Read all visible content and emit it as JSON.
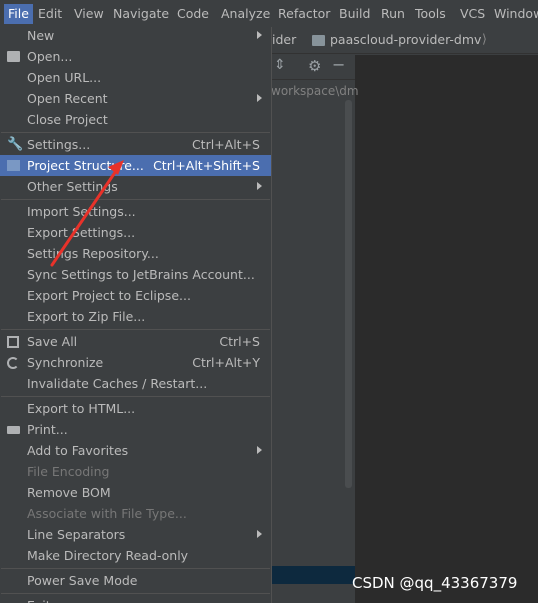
{
  "menubar": {
    "items": [
      "File",
      "Edit",
      "View",
      "Navigate",
      "Code",
      "Analyze",
      "Refactor",
      "Build",
      "Run",
      "Tools",
      "VCS",
      "Window"
    ]
  },
  "breadcrumb": {
    "first": "ider",
    "project": "paascloud-provider-dmv",
    "sep": "⟩"
  },
  "editor": {
    "path_text": "workspace\\dm"
  },
  "file_menu": {
    "items": {
      "new": {
        "label": "New"
      },
      "open": {
        "label": "Open..."
      },
      "open_url": {
        "label": "Open URL..."
      },
      "open_recent": {
        "label": "Open Recent"
      },
      "close_project": {
        "label": "Close Project"
      },
      "settings": {
        "label": "Settings...",
        "shortcut": "Ctrl+Alt+S"
      },
      "project_structure": {
        "label": "Project Structure...",
        "shortcut": "Ctrl+Alt+Shift+S"
      },
      "other_settings": {
        "label": "Other Settings"
      },
      "import_settings": {
        "label": "Import Settings..."
      },
      "export_settings": {
        "label": "Export Settings..."
      },
      "settings_repository": {
        "label": "Settings Repository..."
      },
      "sync_settings": {
        "label": "Sync Settings to JetBrains Account..."
      },
      "export_eclipse": {
        "label": "Export Project to Eclipse..."
      },
      "export_zip": {
        "label": "Export to Zip File..."
      },
      "save_all": {
        "label": "Save All",
        "shortcut": "Ctrl+S"
      },
      "synchronize": {
        "label": "Synchronize",
        "shortcut": "Ctrl+Alt+Y"
      },
      "invalidate_caches": {
        "label": "Invalidate Caches / Restart..."
      },
      "export_html": {
        "label": "Export to HTML..."
      },
      "print": {
        "label": "Print..."
      },
      "add_favorites": {
        "label": "Add to Favorites"
      },
      "file_encoding": {
        "label": "File Encoding"
      },
      "remove_bom": {
        "label": "Remove BOM"
      },
      "associate_file_type": {
        "label": "Associate with File Type..."
      },
      "line_separators": {
        "label": "Line Separators"
      },
      "make_readonly": {
        "label": "Make Directory Read-only"
      },
      "power_save": {
        "label": "Power Save Mode"
      },
      "exit": {
        "label": "Exit"
      }
    }
  },
  "watermark": "CSDN @qq_43367379",
  "colors": {
    "highlight": "#4b6eaf",
    "menu_bg": "#3c3f41",
    "editor_bg": "#2b2b2b",
    "arrow": "#e8322a"
  }
}
